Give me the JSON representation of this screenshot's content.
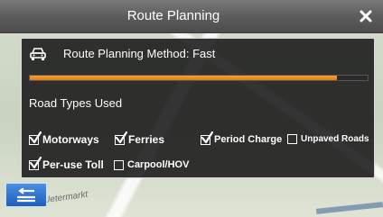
{
  "window": {
    "title": "Route Planning",
    "close_icon": "close-icon"
  },
  "route_method": {
    "label": "Route Planning Method: Fast",
    "icon": "car-icon",
    "progress": 0.91
  },
  "road_types": {
    "title": "Road Types Used",
    "options": [
      {
        "label": "Motorways",
        "checked": true
      },
      {
        "label": "Ferries",
        "checked": true
      },
      {
        "label": "Period Charge",
        "checked": true
      },
      {
        "label": "Unpaved Roads",
        "checked": false
      },
      {
        "label": "Per-use Toll",
        "checked": true
      },
      {
        "label": "Carpool/HOV",
        "checked": false
      }
    ]
  },
  "back": {
    "icon": "back-arrow-icon"
  },
  "map": {
    "label": "Uetermarkt"
  },
  "colors": {
    "accent": "#f08c1e",
    "back_button": "#2d74d4"
  }
}
